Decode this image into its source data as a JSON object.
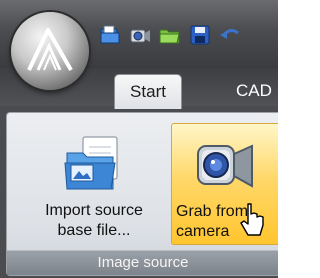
{
  "tabs": [
    {
      "label": "Start",
      "active": true
    },
    {
      "label": "CAD",
      "active": false
    }
  ],
  "quick_access": [
    "open-folder-icon",
    "camera-icon",
    "folder-icon",
    "save-icon",
    "undo-icon"
  ],
  "ribbon": {
    "group_label": "Image source",
    "buttons": [
      {
        "line1": "Import source",
        "line2": "base file...",
        "icon": "import-file-icon"
      },
      {
        "line1": "Grab from",
        "line2": "camera",
        "icon": "camera-icon",
        "highlighted": true
      }
    ]
  },
  "colors": {
    "hover": "#ffd86a",
    "frame": "#4a4c50",
    "tab_active": "#f7f7f7"
  }
}
